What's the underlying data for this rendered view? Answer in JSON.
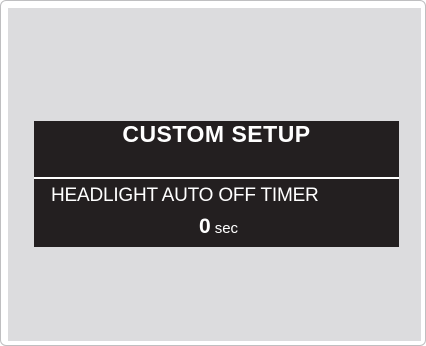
{
  "display": {
    "title": "CUSTOM SETUP",
    "setting_label": "HEADLIGHT AUTO OFF TIMER",
    "value": "0",
    "unit": "sec"
  },
  "colors": {
    "panel_background": "#dcdcde",
    "display_background": "#231f20",
    "text": "#ffffff"
  }
}
